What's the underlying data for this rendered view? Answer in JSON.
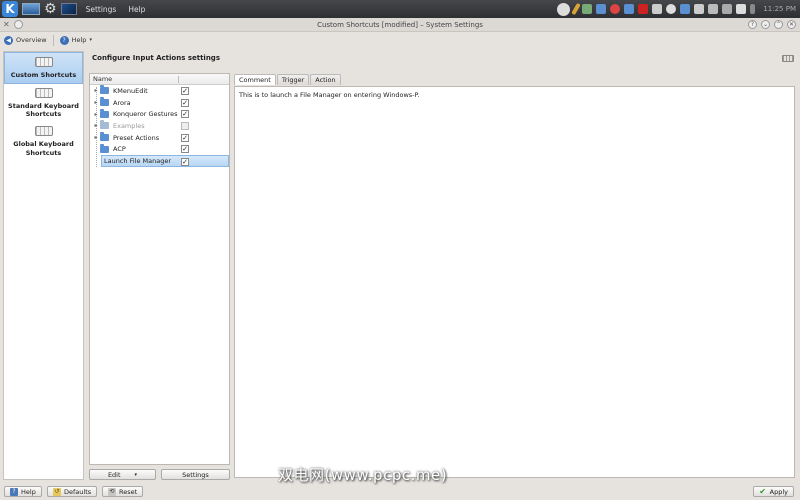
{
  "system_panel": {
    "menus": [
      "Settings",
      "Help"
    ],
    "clock": "11:25 PM"
  },
  "window": {
    "title": "Custom Shortcuts [modified] – System Settings"
  },
  "toolbar": {
    "overview_label": "Overview",
    "help_label": "Help"
  },
  "sidebar": {
    "items": [
      {
        "label": "Custom Shortcuts",
        "active": true
      },
      {
        "label": "Standard Keyboard Shortcuts",
        "active": false
      },
      {
        "label": "Global Keyboard Shortcuts",
        "active": false
      }
    ]
  },
  "page": {
    "title": "Configure Input Actions settings"
  },
  "tree": {
    "column_name": "Name",
    "rows": [
      {
        "label": "KMenuEdit",
        "checked": true
      },
      {
        "label": "Arora",
        "checked": true
      },
      {
        "label": "Konqueror Gestures",
        "checked": true
      },
      {
        "label": "Examples",
        "checked": false
      },
      {
        "label": "Preset Actions",
        "checked": true
      },
      {
        "label": "ACP",
        "checked": true
      },
      {
        "label": "Launch File Manager",
        "checked": true
      }
    ],
    "edit_label": "Edit",
    "settings_label": "Settings"
  },
  "tabs": {
    "items": [
      "Comment",
      "Trigger",
      "Action"
    ],
    "comment_text": "This is to launch a File Manager on entering Windows-P."
  },
  "bottom": {
    "help_label": "Help",
    "defaults_label": "Defaults",
    "reset_label": "Reset",
    "apply_label": "Apply"
  },
  "watermark": "双电网(www.pcpc.me)"
}
